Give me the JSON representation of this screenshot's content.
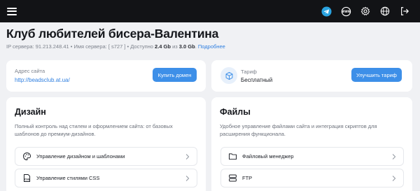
{
  "topbar": {
    "icons": [
      "menu-icon",
      "telegram-icon",
      "www-icon",
      "settings-icon",
      "globe-icon",
      "exit-icon"
    ],
    "telegram_color": "#2aa3e0"
  },
  "header": {
    "title": "Клуб любителей бисера-Валентина",
    "ip_label": "IP сервера: 91.213.248.41",
    "sep1": " • ",
    "server_name": "Имя сервера: [ s727 ]",
    "sep2": " • ",
    "available_prefix": "Доступно ",
    "used": "2.4 Gb",
    "of": " из ",
    "total": "3.0 Gb",
    "sep3": ". ",
    "more_link": "Подробнее"
  },
  "site_card": {
    "label": "Адрес сайта",
    "url": "http://beadsclub.at.ua/",
    "button": "Купить домен"
  },
  "tariff_card": {
    "label": "Тариф",
    "plan": "Бесплатный",
    "button": "Улучшить тариф"
  },
  "design": {
    "title": "Дизайн",
    "description": "Полный контроль над стилем и оформлением сайта: от базовых шаблонов до премиум-дизайнов.",
    "items": [
      {
        "label": "Управление дизайном и шаблонами",
        "icon": "palette-icon"
      },
      {
        "label": "Управление стилями CSS",
        "icon": "css-file-icon"
      }
    ]
  },
  "files": {
    "title": "Файлы",
    "description": "Удобное управление файлами сайта и интеграция скриптов для расширения функционала.",
    "items": [
      {
        "label": "Файловый менеджер",
        "icon": "folder-icon"
      },
      {
        "label": "FTP",
        "icon": "server-icon"
      }
    ]
  },
  "colors": {
    "accent": "#3d8fe8",
    "link": "#2f7fe0",
    "topbar": "#121316",
    "background": "#f0f1f4"
  }
}
